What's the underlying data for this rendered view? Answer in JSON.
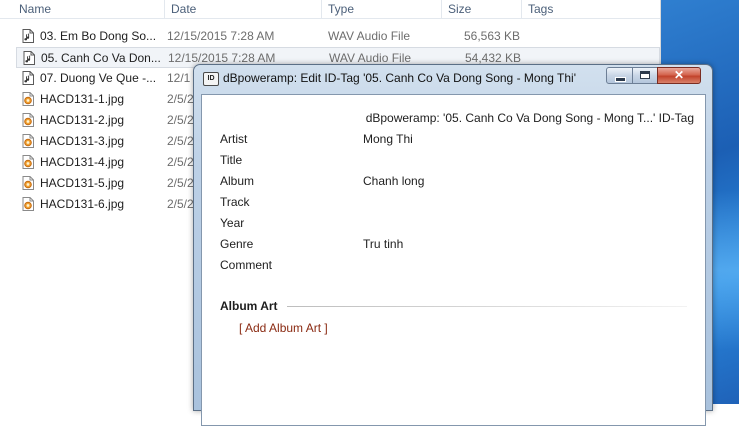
{
  "explorer": {
    "columns": {
      "name": "Name",
      "date": "Date",
      "type": "Type",
      "size": "Size",
      "tags": "Tags"
    },
    "files": [
      {
        "name": "03. Em Bo Dong So...",
        "date": "12/15/2015 7:28 AM",
        "type": "WAV Audio File",
        "size": "56,563 KB",
        "icon": "audio-file-icon"
      },
      {
        "name": "05. Canh Co Va Don...",
        "date": "12/15/2015 7:28 AM",
        "type": "WAV Audio File",
        "size": "54,432 KB",
        "icon": "audio-file-icon"
      },
      {
        "name": "07. Duong Ve Que -...",
        "date": "12/1",
        "type": "",
        "size": "",
        "icon": "audio-file-icon"
      },
      {
        "name": "HACD131-1.jpg",
        "date": "2/5/2",
        "type": "",
        "size": "",
        "icon": "image-file-icon"
      },
      {
        "name": "HACD131-2.jpg",
        "date": "2/5/2",
        "type": "",
        "size": "",
        "icon": "image-file-icon"
      },
      {
        "name": "HACD131-3.jpg",
        "date": "2/5/2",
        "type": "",
        "size": "",
        "icon": "image-file-icon"
      },
      {
        "name": "HACD131-4.jpg",
        "date": "2/5/2",
        "type": "",
        "size": "",
        "icon": "image-file-icon"
      },
      {
        "name": "HACD131-5.jpg",
        "date": "2/5/2",
        "type": "",
        "size": "",
        "icon": "image-file-icon"
      },
      {
        "name": "HACD131-6.jpg",
        "date": "2/5/2",
        "type": "",
        "size": "",
        "icon": "image-file-icon"
      }
    ]
  },
  "dialog": {
    "app_icon_text": "ID",
    "title": "dBpoweramp: Edit ID-Tag '05. Canh Co Va Dong Song - Mong Thi'",
    "heading": "dBpoweramp: '05. Canh Co Va Dong Song - Mong T...' ID-Tag",
    "fields": [
      {
        "label": "Artist",
        "value": "Mong Thi"
      },
      {
        "label": "Title",
        "value": ""
      },
      {
        "label": "Album",
        "value": "Chanh long"
      },
      {
        "label": "Track",
        "value": ""
      },
      {
        "label": "Year",
        "value": ""
      },
      {
        "label": "Genre",
        "value": "Tru tinh"
      },
      {
        "label": "Comment",
        "value": ""
      }
    ],
    "album_art_heading": "Album Art",
    "add_album_art": "[ Add Album Art ]",
    "buttons": {
      "minimize": "minimize-icon",
      "maximize": "maximize-icon",
      "close": "close-icon"
    }
  },
  "colors": {
    "link": "#8a2a12",
    "close_button": "#c2432c",
    "desktop": "#1c5fb4"
  }
}
